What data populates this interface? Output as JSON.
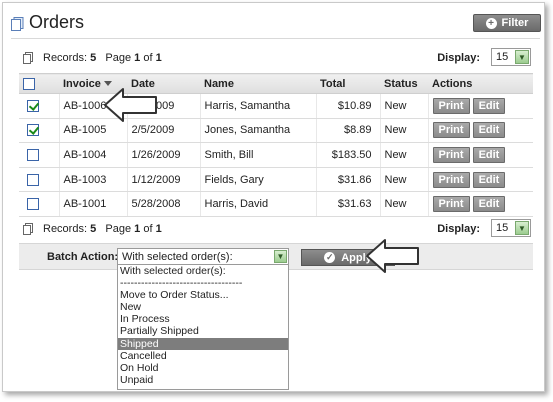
{
  "header": {
    "title": "Orders",
    "filter_label": "Filter"
  },
  "pager_top": {
    "records_label": "Records:",
    "records_count": "5",
    "page_prefix": "Page",
    "page_current": "1",
    "page_of": "of",
    "page_total": "1",
    "display_label": "Display:",
    "display_value": "15"
  },
  "pager_bottom": {
    "records_label": "Records:",
    "records_count": "5",
    "page_prefix": "Page",
    "page_current": "1",
    "page_of": "of",
    "page_total": "1",
    "display_label": "Display:",
    "display_value": "15"
  },
  "table": {
    "columns": {
      "invoice": "Invoice",
      "date": "Date",
      "name": "Name",
      "total": "Total",
      "status": "Status",
      "actions": "Actions"
    },
    "rows": [
      {
        "checked": true,
        "invoice": "AB-1006",
        "date": "2/9/2009",
        "name": "Harris, Samantha",
        "total": "$10.89",
        "status": "New",
        "print": "Print",
        "edit": "Edit"
      },
      {
        "checked": true,
        "invoice": "AB-1005",
        "date": "2/5/2009",
        "name": "Jones, Samantha",
        "total": "$8.89",
        "status": "New",
        "print": "Print",
        "edit": "Edit"
      },
      {
        "checked": false,
        "invoice": "AB-1004",
        "date": "1/26/2009",
        "name": "Smith, Bill",
        "total": "$183.50",
        "status": "New",
        "print": "Print",
        "edit": "Edit"
      },
      {
        "checked": false,
        "invoice": "AB-1003",
        "date": "1/12/2009",
        "name": "Fields, Gary",
        "total": "$31.86",
        "status": "New",
        "print": "Print",
        "edit": "Edit"
      },
      {
        "checked": false,
        "invoice": "AB-1001",
        "date": "5/28/2008",
        "name": "Harris, David",
        "total": "$31.63",
        "status": "New",
        "print": "Print",
        "edit": "Edit"
      }
    ]
  },
  "batch": {
    "label": "Batch Action:",
    "selected": "With selected order(s):",
    "apply_label": "Apply",
    "options": [
      "With selected order(s):",
      "-----------------------------------",
      "Move to Order Status...",
      "New",
      "In Process",
      "Partially Shipped",
      "Shipped",
      "Cancelled",
      "On Hold",
      "Unpaid"
    ],
    "highlighted_index": 6
  },
  "colors": {
    "accent_button": "#7a7a7a",
    "select_arrow": "#9ccc8f",
    "checkbox_check": "#1a8a1a"
  }
}
